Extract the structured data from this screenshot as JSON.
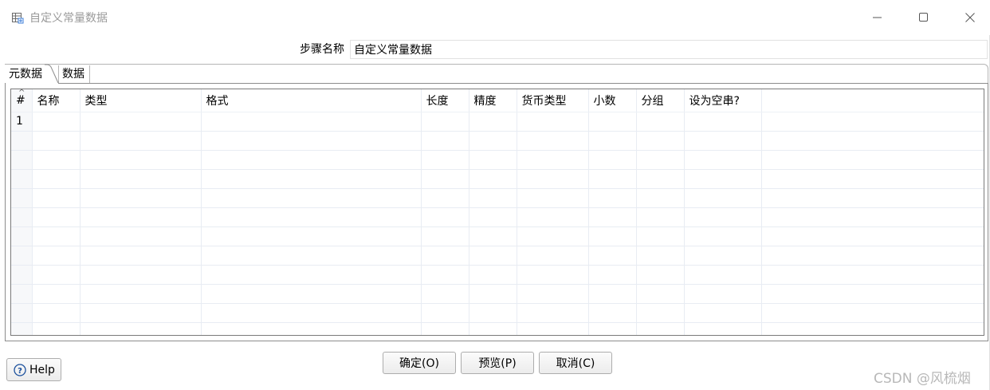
{
  "window": {
    "title": "自定义常量数据",
    "icon": "table-grid-icon"
  },
  "step": {
    "label": "步骤名称",
    "value": "自定义常量数据"
  },
  "tabs": [
    {
      "label": "元数据",
      "active": true
    },
    {
      "label": "数据",
      "active": false
    }
  ],
  "table": {
    "columns": [
      "#",
      "名称",
      "类型",
      "格式",
      "长度",
      "精度",
      "货币类型",
      "小数",
      "分组",
      "设为空串?",
      ""
    ],
    "rows": [
      [
        "1",
        "",
        "",
        "",
        "",
        "",
        "",
        "",
        "",
        "",
        ""
      ],
      [
        "",
        "",
        "",
        "",
        "",
        "",
        "",
        "",
        "",
        "",
        ""
      ],
      [
        "",
        "",
        "",
        "",
        "",
        "",
        "",
        "",
        "",
        "",
        ""
      ],
      [
        "",
        "",
        "",
        "",
        "",
        "",
        "",
        "",
        "",
        "",
        ""
      ],
      [
        "",
        "",
        "",
        "",
        "",
        "",
        "",
        "",
        "",
        "",
        ""
      ],
      [
        "",
        "",
        "",
        "",
        "",
        "",
        "",
        "",
        "",
        "",
        ""
      ],
      [
        "",
        "",
        "",
        "",
        "",
        "",
        "",
        "",
        "",
        "",
        ""
      ],
      [
        "",
        "",
        "",
        "",
        "",
        "",
        "",
        "",
        "",
        "",
        ""
      ],
      [
        "",
        "",
        "",
        "",
        "",
        "",
        "",
        "",
        "",
        "",
        ""
      ],
      [
        "",
        "",
        "",
        "",
        "",
        "",
        "",
        "",
        "",
        "",
        ""
      ],
      [
        "",
        "",
        "",
        "",
        "",
        "",
        "",
        "",
        "",
        "",
        ""
      ],
      [
        "",
        "",
        "",
        "",
        "",
        "",
        "",
        "",
        "",
        "",
        ""
      ]
    ]
  },
  "buttons": {
    "ok": "确定(O)",
    "preview": "预览(P)",
    "cancel": "取消(C)",
    "help": "Help"
  },
  "watermark": "CSDN @风梳烟"
}
